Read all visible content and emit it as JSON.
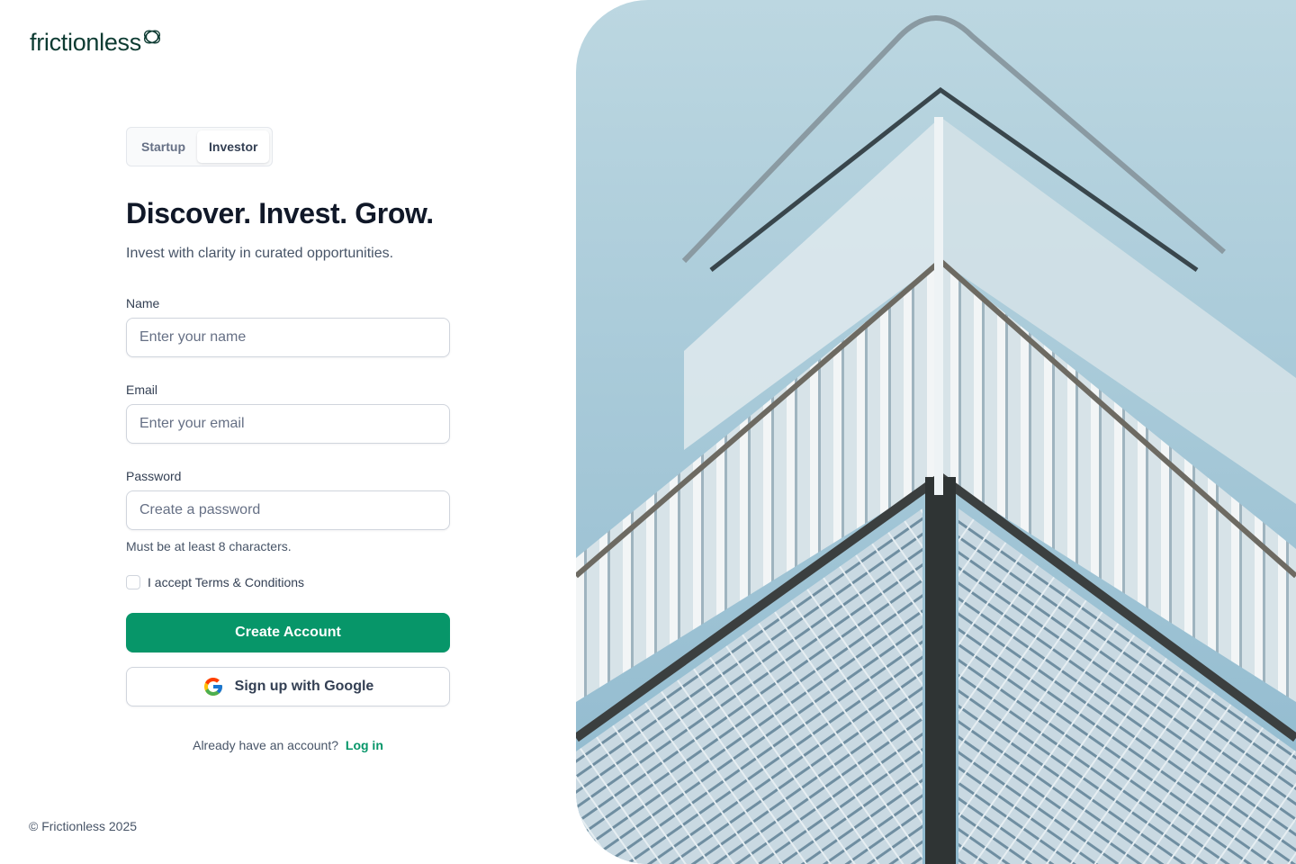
{
  "brand": {
    "name": "frictionless",
    "accent": "#079669",
    "logo_color": "#0d3b32"
  },
  "tabs": [
    {
      "label": "Startup",
      "active": false
    },
    {
      "label": "Investor",
      "active": true
    }
  ],
  "hero": {
    "title": "Discover. Invest. Grow.",
    "subtitle": "Invest with clarity in curated opportunities."
  },
  "form": {
    "name": {
      "label": "Name",
      "placeholder": "Enter your name",
      "value": ""
    },
    "email": {
      "label": "Email",
      "placeholder": "Enter your email",
      "value": ""
    },
    "password": {
      "label": "Password",
      "placeholder": "Create a password",
      "value": "",
      "hint": "Must be at least 8 characters."
    },
    "terms": {
      "label": "I accept Terms & Conditions",
      "checked": false
    },
    "submit_label": "Create Account",
    "google_label": "Sign up with Google",
    "google_icon": "google-icon"
  },
  "login": {
    "prompt": "Already have an account?",
    "link_label": "Log in"
  },
  "footer": {
    "copyright": "© Frictionless 2025"
  },
  "image": {
    "subject": "glass-building-photo"
  }
}
